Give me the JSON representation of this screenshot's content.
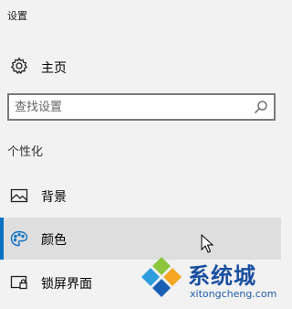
{
  "window": {
    "title": "设置"
  },
  "home": {
    "label": "主页",
    "icon": "gear-icon"
  },
  "search": {
    "placeholder": "查找设置",
    "value": "",
    "icon": "search-icon"
  },
  "section": {
    "label": "个性化"
  },
  "nav": {
    "items": [
      {
        "label": "背景",
        "icon": "picture-icon",
        "selected": false
      },
      {
        "label": "颜色",
        "icon": "palette-icon",
        "selected": true
      },
      {
        "label": "锁屏界面",
        "icon": "lock-screen-icon",
        "selected": false
      }
    ]
  },
  "watermark": {
    "brand": "系统城",
    "url": "xitongcheng.com"
  },
  "colors": {
    "accent": "#0b6fc2",
    "selected_bg": "#dedede",
    "background": "#f2f2f2"
  }
}
